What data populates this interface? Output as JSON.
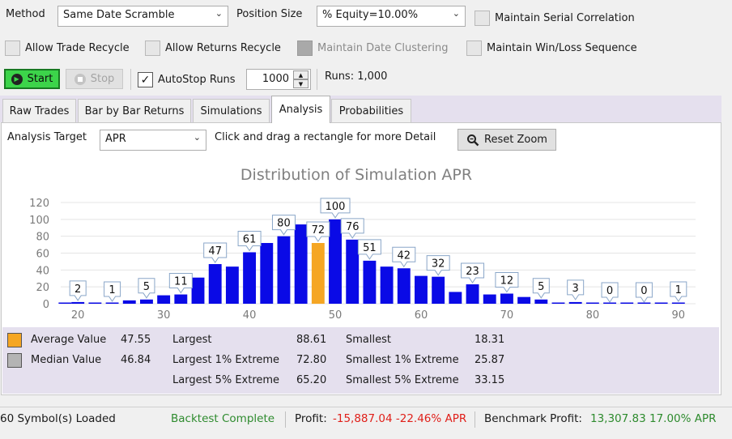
{
  "settings": {
    "method_label": "Method",
    "method_value": "Same Date Scramble",
    "position_size_label": "Position Size",
    "position_size_value": "% Equity=10.00%",
    "maintain_serial_correlation": "Maintain Serial Correlation",
    "allow_trade_recycle": "Allow Trade Recycle",
    "allow_returns_recycle": "Allow Returns Recycle",
    "maintain_date_clustering": "Maintain Date Clustering",
    "maintain_win_loss_sequence": "Maintain Win/Loss Sequence"
  },
  "controls": {
    "start_label": "Start",
    "stop_label": "Stop",
    "autostop_label": "AutoStop Runs",
    "autostop_checked": "✓",
    "runs_value": "1000",
    "runs_status": "Runs: 1,000"
  },
  "tabs": [
    {
      "label": "Raw Trades"
    },
    {
      "label": "Bar by Bar Returns"
    },
    {
      "label": "Simulations"
    },
    {
      "label": "Analysis"
    },
    {
      "label": "Probabilities"
    }
  ],
  "analysis": {
    "target_label": "Analysis Target",
    "target_value": "APR",
    "hint": "Click and drag a rectangle for more Detail",
    "reset_zoom_label": "Reset Zoom"
  },
  "chart_data": {
    "type": "bar",
    "title": "Distribution of Simulation APR",
    "xlabel": "",
    "ylabel": "",
    "xlim": [
      18,
      92
    ],
    "ylim": [
      0,
      120
    ],
    "x_ticks": [
      20,
      30,
      40,
      50,
      60,
      70,
      80,
      90
    ],
    "y_ticks": [
      0,
      20,
      40,
      60,
      80,
      100,
      120
    ],
    "bar_width": 1.5,
    "grid": true,
    "x": [
      18.5,
      20,
      22,
      24,
      26,
      28,
      30,
      32,
      34,
      36,
      38,
      40,
      42,
      44,
      46,
      48,
      50,
      52,
      54,
      56,
      58,
      60,
      62,
      64,
      66,
      68,
      70,
      72,
      74,
      76,
      78,
      80,
      82,
      84,
      86,
      88,
      90
    ],
    "values": [
      1,
      2,
      1,
      1,
      4,
      5,
      10,
      11,
      31,
      47,
      44,
      61,
      72,
      80,
      94,
      72,
      100,
      76,
      51,
      44,
      42,
      33,
      32,
      14,
      23,
      11,
      12,
      8,
      5,
      1,
      2,
      1,
      1,
      0,
      0,
      0,
      1
    ],
    "highlight_index": 15,
    "labels": [
      {
        "x": 20,
        "value": 2,
        "text": "2"
      },
      {
        "x": 24,
        "value": 1,
        "text": "1"
      },
      {
        "x": 28,
        "value": 5,
        "text": "5"
      },
      {
        "x": 32,
        "value": 11,
        "text": "11"
      },
      {
        "x": 36,
        "value": 47,
        "text": "47"
      },
      {
        "x": 40,
        "value": 61,
        "text": "61"
      },
      {
        "x": 44,
        "value": 80,
        "text": "80"
      },
      {
        "x": 48,
        "value": 72,
        "text": "72"
      },
      {
        "x": 50,
        "value": 100,
        "text": "100"
      },
      {
        "x": 52,
        "value": 76,
        "text": "76"
      },
      {
        "x": 54,
        "value": 51,
        "text": "51"
      },
      {
        "x": 58,
        "value": 42,
        "text": "42"
      },
      {
        "x": 62,
        "value": 32,
        "text": "32"
      },
      {
        "x": 66,
        "value": 23,
        "text": "23"
      },
      {
        "x": 70,
        "value": 12,
        "text": "12"
      },
      {
        "x": 74,
        "value": 5,
        "text": "5"
      },
      {
        "x": 78,
        "value": 3,
        "text": "3"
      },
      {
        "x": 82,
        "value": 0,
        "text": "0"
      },
      {
        "x": 86,
        "value": 0,
        "text": "0"
      },
      {
        "x": 90,
        "value": 1,
        "text": "1"
      }
    ],
    "colors": {
      "bar": "#0a0ae6",
      "highlight": "#f5a623",
      "grid": "#e4e4e4",
      "title": "#808080",
      "axis_text": "#7a7a7a"
    }
  },
  "stats": {
    "average_label": "Average Value",
    "average_value": "47.55",
    "average_color": "#f5a623",
    "median_label": "Median Value",
    "median_value": "46.84",
    "median_color": "#b4b4b4",
    "largest_label": "Largest",
    "largest_value": "88.61",
    "largest1_label": "Largest 1% Extreme",
    "largest1_value": "72.80",
    "largest5_label": "Largest 5% Extreme",
    "largest5_value": "65.20",
    "smallest_label": "Smallest",
    "smallest_value": "18.31",
    "smallest1_label": "Smallest 1% Extreme",
    "smallest1_value": "25.87",
    "smallest5_label": "Smallest 5% Extreme",
    "smallest5_value": "33.15"
  },
  "status": {
    "symbols": "60 Symbol(s) Loaded",
    "backtest": "Backtest Complete",
    "backtest_color": "#2e8b2e",
    "profit_label": "Profit:",
    "profit_value": "-15,887.04 -22.46% APR",
    "profit_color": "#e0201a",
    "benchmark_label": "Benchmark Profit:",
    "benchmark_value": "13,307.83 17.00% APR",
    "benchmark_color": "#2e8b2e"
  }
}
